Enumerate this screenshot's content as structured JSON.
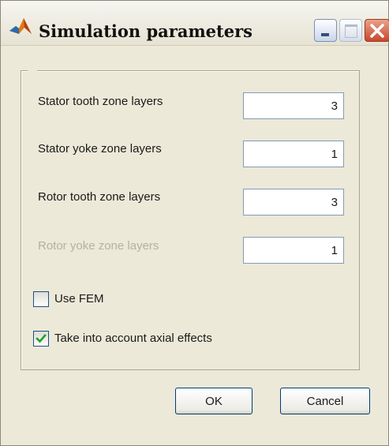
{
  "window": {
    "title": "Simulation parameters",
    "icon": "matlab-icon"
  },
  "titlebar_buttons": [
    "minimize-icon",
    "maximize-icon",
    "close-icon"
  ],
  "fields": [
    {
      "label": "Stator tooth zone layers",
      "value": "3",
      "enabled": true
    },
    {
      "label": "Stator yoke zone layers",
      "value": "1",
      "enabled": true
    },
    {
      "label": "Rotor tooth zone layers",
      "value": "3",
      "enabled": true
    },
    {
      "label": "Rotor yoke zone layers",
      "value": "1",
      "enabled": false
    }
  ],
  "checkboxes": [
    {
      "label": "Use FEM",
      "checked": false
    },
    {
      "label": "Take into account axial effects",
      "checked": true
    }
  ],
  "buttons": {
    "ok_label": "OK",
    "cancel_label": "Cancel"
  },
  "colors": {
    "dialog_background": "#ece9d8",
    "disabled_text": "#b4b1a2",
    "check_mark": "#21a121",
    "close_button": "#c8472d"
  }
}
